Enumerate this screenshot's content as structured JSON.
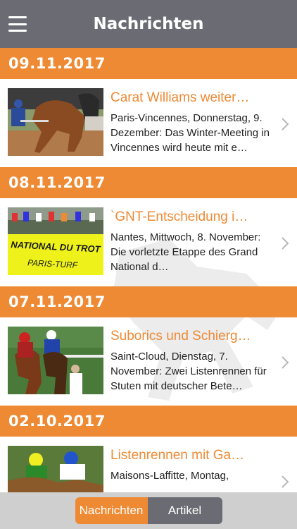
{
  "header": {
    "title": "Nachrichten",
    "menu_icon": "hamburger-menu-icon"
  },
  "sections": [
    {
      "date": "09.11.2017",
      "article": {
        "title": "Carat Williams weiter…",
        "description": "Paris-Vincennes, Donnerstag, 9. Dezember: Das Winter-Meeting in Vincennes wird heute mit e…"
      }
    },
    {
      "date": "08.11.2017",
      "article": {
        "title": "`GNT-Entscheidung i…",
        "description": "Nantes, Mittwoch, 8. November: Die vorletzte Etappe des Grand National d…",
        "banner_line1": "NATIONAL DU TROT",
        "banner_line2": "PARIS-TURF"
      }
    },
    {
      "date": "07.11.2017",
      "article": {
        "title": "Suborics und Schierg…",
        "description": "Saint-Cloud, Dienstag, 7. November: Zwei Listenrennen für Stuten mit deutscher Bete…"
      }
    },
    {
      "date": "02.10.2017",
      "article": {
        "title": "Listenrennen mit Ga…",
        "description": "Maisons-Laffitte, Montag,"
      }
    }
  ],
  "tabs": {
    "active": "Nachrichten",
    "inactive": "Artikel"
  },
  "colors": {
    "accent": "#ee8a34",
    "header": "#6b6c73",
    "tabbar": "#cfcfcf"
  }
}
